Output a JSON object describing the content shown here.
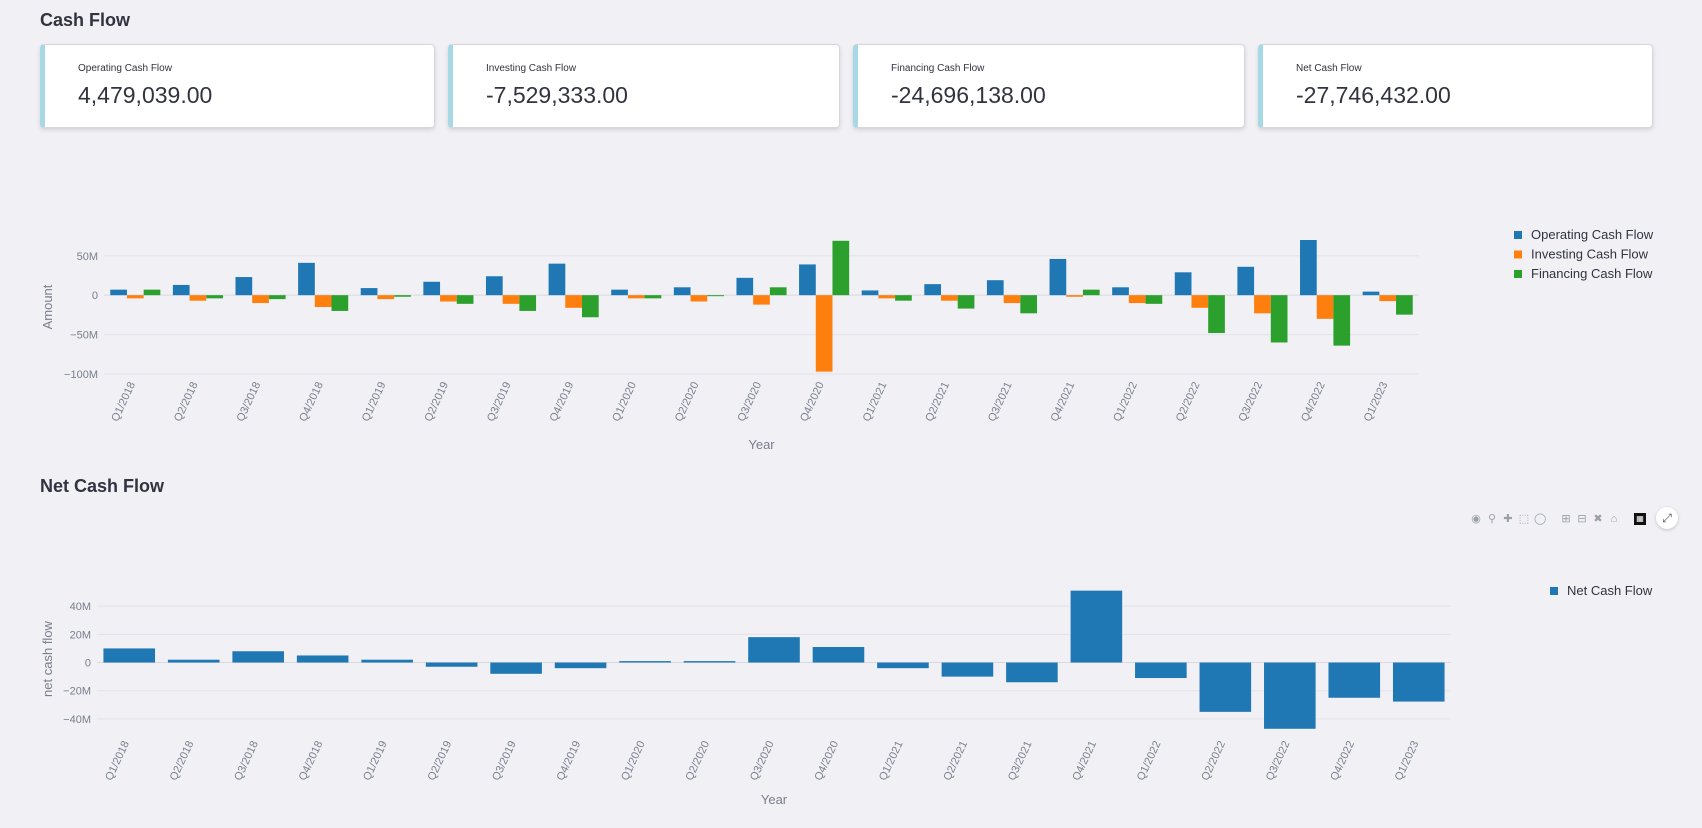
{
  "sections": {
    "cash_flow_title": "Cash Flow",
    "net_cash_flow_title": "Net Cash Flow"
  },
  "metrics": [
    {
      "label": "Operating Cash Flow",
      "value": "4,479,039.00"
    },
    {
      "label": "Investing Cash Flow",
      "value": "-7,529,333.00"
    },
    {
      "label": "Financing Cash Flow",
      "value": "-24,696,138.00"
    },
    {
      "label": "Net Cash Flow",
      "value": "-27,746,432.00"
    }
  ],
  "toolbar": {
    "icons": [
      "camera-icon",
      "zoom-icon",
      "pan-icon",
      "box-select-icon",
      "lasso-select-icon",
      "zoom-in-icon",
      "zoom-out-icon",
      "autoscale-icon",
      "reset-axes-icon",
      "plotly-logo-icon"
    ]
  },
  "colors": {
    "operating": "#1f77b4",
    "investing": "#ff7f0e",
    "financing": "#2ca02c",
    "net": "#1f77b4",
    "card_accent": "#a7d8e6"
  },
  "chart_data": [
    {
      "type": "bar",
      "title": "",
      "xlabel": "Year",
      "ylabel": "Amount",
      "categories": [
        "Q1/2018",
        "Q2/2018",
        "Q3/2018",
        "Q4/2018",
        "Q1/2019",
        "Q2/2019",
        "Q3/2019",
        "Q4/2019",
        "Q1/2020",
        "Q2/2020",
        "Q3/2020",
        "Q4/2020",
        "Q1/2021",
        "Q2/2021",
        "Q3/2021",
        "Q4/2021",
        "Q1/2022",
        "Q2/2022",
        "Q3/2022",
        "Q4/2022",
        "Q1/2023"
      ],
      "ylim": [
        -100000000,
        70000000
      ],
      "yticks": [
        {
          "value": 50000000,
          "label": "50M"
        },
        {
          "value": 0,
          "label": "0"
        },
        {
          "value": -50000000,
          "label": "−50M"
        },
        {
          "value": -100000000,
          "label": "−100M"
        }
      ],
      "grid": true,
      "legend": "top-right",
      "series": [
        {
          "name": "Operating Cash Flow",
          "values": [
            7000000,
            13000000,
            23000000,
            41000000,
            9000000,
            17000000,
            24000000,
            40000000,
            7000000,
            10000000,
            22000000,
            39000000,
            6000000,
            14000000,
            19000000,
            46000000,
            10000000,
            29000000,
            36000000,
            70000000,
            4500000
          ]
        },
        {
          "name": "Investing Cash Flow",
          "values": [
            -4000000,
            -7000000,
            -10000000,
            -15000000,
            -5000000,
            -8000000,
            -11000000,
            -16000000,
            -4000000,
            -8000000,
            -12000000,
            -97000000,
            -4000000,
            -7000000,
            -10000000,
            -2000000,
            -10000000,
            -16000000,
            -23000000,
            -30000000,
            -7500000
          ]
        },
        {
          "name": "Financing Cash Flow",
          "values": [
            7000000,
            -4000000,
            -5000000,
            -20000000,
            -2000000,
            -11000000,
            -20000000,
            -28000000,
            -4000000,
            -1000000,
            10000000,
            69000000,
            -7000000,
            -17000000,
            -23000000,
            7000000,
            -11000000,
            -48000000,
            -60000000,
            -64000000,
            -24700000
          ]
        }
      ]
    },
    {
      "type": "bar",
      "title": "",
      "xlabel": "Year",
      "ylabel": "net cash flow",
      "categories": [
        "Q1/2018",
        "Q2/2018",
        "Q3/2018",
        "Q4/2018",
        "Q1/2019",
        "Q2/2019",
        "Q3/2019",
        "Q4/2019",
        "Q1/2020",
        "Q2/2020",
        "Q3/2020",
        "Q4/2020",
        "Q1/2021",
        "Q2/2021",
        "Q3/2021",
        "Q4/2021",
        "Q1/2022",
        "Q2/2022",
        "Q3/2022",
        "Q4/2022",
        "Q1/2023"
      ],
      "ylim": [
        -50000000,
        55000000
      ],
      "yticks": [
        {
          "value": 40000000,
          "label": "40M"
        },
        {
          "value": 20000000,
          "label": "20M"
        },
        {
          "value": 0,
          "label": "0"
        },
        {
          "value": -20000000,
          "label": "−20M"
        },
        {
          "value": -40000000,
          "label": "−40M"
        }
      ],
      "grid": true,
      "legend": "top-right",
      "series": [
        {
          "name": "Net Cash Flow",
          "values": [
            10000000,
            2000000,
            8000000,
            5000000,
            2000000,
            -3000000,
            -8000000,
            -4000000,
            1000000,
            1000000,
            18000000,
            11000000,
            -4000000,
            -10000000,
            -14000000,
            51000000,
            -11000000,
            -35000000,
            -47000000,
            -25000000,
            -27700000
          ]
        }
      ]
    }
  ]
}
